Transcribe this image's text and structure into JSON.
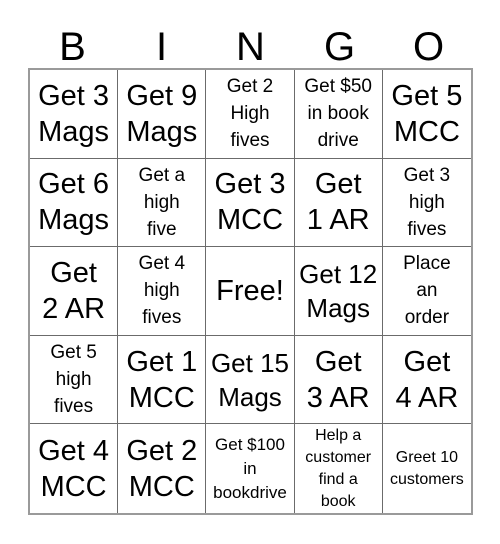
{
  "card": {
    "title": "BINGO",
    "header_letters": [
      "B",
      "I",
      "N",
      "G",
      "O"
    ],
    "colors": {
      "background": "#ffffff",
      "text": "#000000",
      "grid_line": "#6b6b6b",
      "grid_outer": "#9a9a9a"
    },
    "grid": {
      "rows": 5,
      "columns": 5,
      "free_space": "Free!"
    },
    "cells": [
      {
        "text": "Get 3\nMags",
        "size": "sz-xl",
        "lines": 2
      },
      {
        "text": "Get 9\nMags",
        "size": "sz-xl",
        "lines": 2
      },
      {
        "text": "Get 2\nHigh\nfives",
        "size": "sz-sm",
        "lines": 3
      },
      {
        "text": "Get $50\nin book\ndrive",
        "size": "sz-sm",
        "lines": 3
      },
      {
        "text": "Get 5\nMCC",
        "size": "sz-xl",
        "lines": 2
      },
      {
        "text": "Get 6\nMags",
        "size": "sz-xl",
        "lines": 2
      },
      {
        "text": "Get a\nhigh\nfive",
        "size": "sz-sm",
        "lines": 3
      },
      {
        "text": "Get 3\nMCC",
        "size": "sz-xl",
        "lines": 2
      },
      {
        "text": "Get\n1 AR",
        "size": "sz-xl",
        "lines": 2
      },
      {
        "text": "Get 3\nhigh\nfives",
        "size": "sz-sm",
        "lines": 3
      },
      {
        "text": "Get\n2 AR",
        "size": "sz-xl",
        "lines": 2
      },
      {
        "text": "Get 4\nhigh\nfives",
        "size": "sz-sm",
        "lines": 3
      },
      {
        "text": "Free!",
        "size": "sz-xl",
        "lines": 1
      },
      {
        "text": "Get 12\nMags",
        "size": "sz-lg",
        "lines": 2
      },
      {
        "text": "Place\nan\norder",
        "size": "sz-sm",
        "lines": 3
      },
      {
        "text": "Get 5\nhigh\nfives",
        "size": "sz-sm",
        "lines": 3
      },
      {
        "text": "Get 1\nMCC",
        "size": "sz-xl",
        "lines": 2
      },
      {
        "text": "Get 15\nMags",
        "size": "sz-lg",
        "lines": 2
      },
      {
        "text": "Get\n3 AR",
        "size": "sz-xl",
        "lines": 2
      },
      {
        "text": "Get\n4 AR",
        "size": "sz-xl",
        "lines": 2
      },
      {
        "text": "Get 4\nMCC",
        "size": "sz-xl",
        "lines": 2
      },
      {
        "text": "Get 2\nMCC",
        "size": "sz-xl",
        "lines": 2
      },
      {
        "text": "Get $100\nin\nbookdrive",
        "size": "sz-xs",
        "lines": 3
      },
      {
        "text": "Help a\ncustomer\nfind a\nbook",
        "size": "sz-xxs",
        "lines": 4
      },
      {
        "text": "Greet 10\ncustomers",
        "size": "sz-xxs",
        "lines": 2
      }
    ]
  }
}
